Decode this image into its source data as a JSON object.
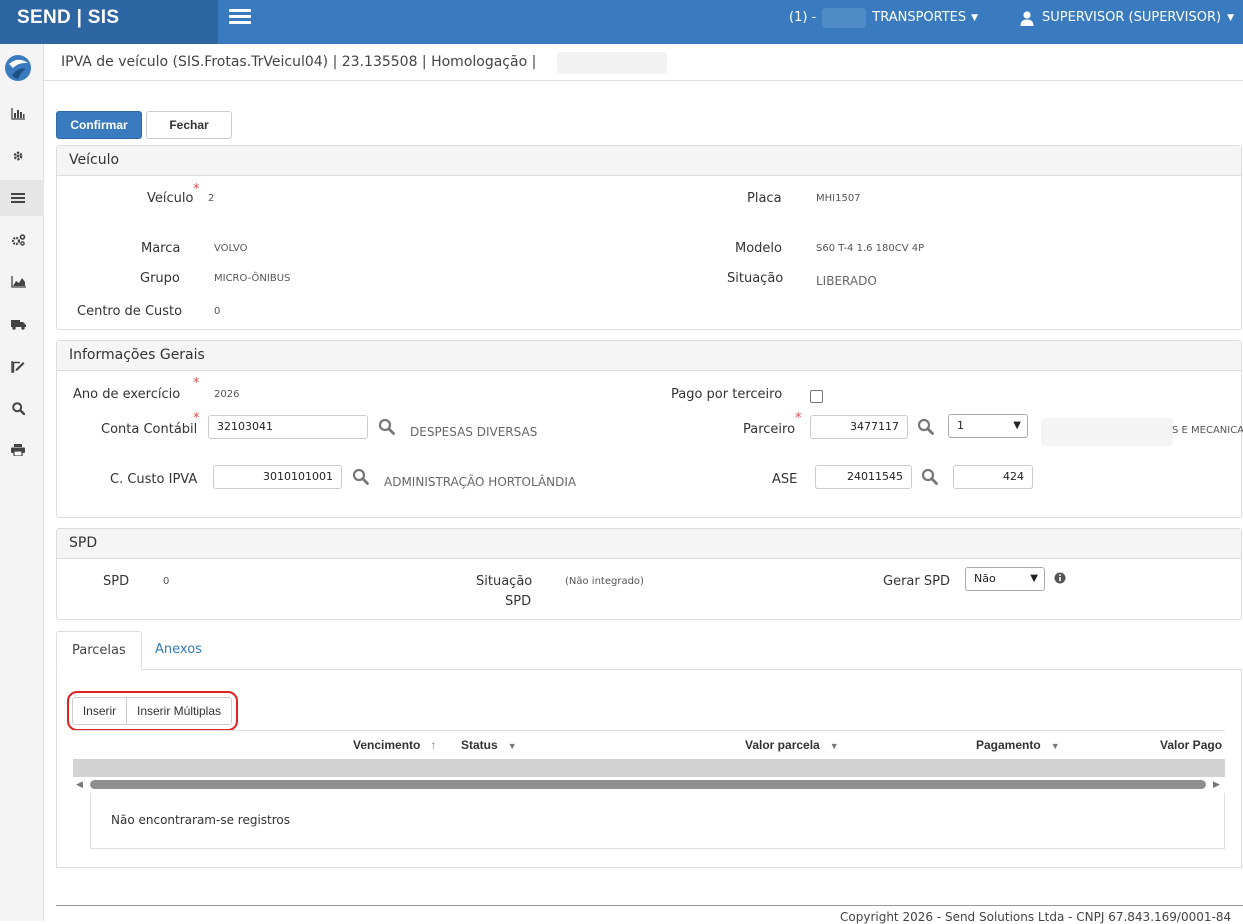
{
  "brand": "SEND | SIS",
  "topbar": {
    "company_prefix": "(1) -",
    "company": "TRANSPORTES",
    "user": "SUPERVISOR (SUPERVISOR)"
  },
  "page": {
    "title": "IPVA de veículo (SIS.Frotas.TrVeicul04) | 23.135508 | Homologação |"
  },
  "actions": {
    "confirm": "Confirmar",
    "close": "Fechar"
  },
  "veiculo": {
    "heading": "Veículo",
    "veiculo_label": "Veículo",
    "veiculo_value": "2",
    "placa_label": "Placa",
    "placa_value": "MHI1507",
    "marca_label": "Marca",
    "marca_value": "VOLVO",
    "modelo_label": "Modelo",
    "modelo_value": "S60 T-4 1.6 180CV 4P",
    "grupo_label": "Grupo",
    "grupo_value": "MICRO-ÔNIBUS",
    "situacao_label": "Situação",
    "situacao_value": "LIBERADO",
    "centro_label": "Centro de Custo",
    "centro_value": "0"
  },
  "info": {
    "heading": "Informações Gerais",
    "ano_label": "Ano de exercício",
    "ano_value": "2026",
    "pago_label": "Pago por terceiro",
    "conta_label": "Conta Contábil",
    "conta_value": "32103041",
    "conta_desc": "DESPESAS DIVERSAS",
    "parceiro_label": "Parceiro",
    "parceiro_value": "3477117",
    "parceiro_select": "1",
    "parceiro_desc": "S E MECANICA L",
    "custo_label": "C. Custo IPVA",
    "custo_value": "3010101001",
    "custo_desc": "ADMINISTRAÇÃO HORTOLÂNDIA",
    "ase_label": "ASE",
    "ase_value": "24011545",
    "ase_extra": "424"
  },
  "spd": {
    "heading": "SPD",
    "spd_label": "SPD",
    "spd_value": "0",
    "situacao_label_1": "Situação",
    "situacao_label_2": "SPD",
    "situacao_value": "(Não integrado)",
    "gerar_label": "Gerar SPD",
    "gerar_value": "Não"
  },
  "tabs": {
    "parcelas": "Parcelas",
    "anexos": "Anexos"
  },
  "parcelas": {
    "inserir": "Inserir",
    "inserir_multiplas": "Inserir Múltiplas",
    "columns": [
      "Vencimento",
      "Status",
      "Valor parcela",
      "Pagamento",
      "Valor Pago"
    ],
    "empty": "Não encontraram-se registros"
  },
  "footer": "Copyright 2026 - Send Solutions Ltda - CNPJ 67.843.169/0001-84"
}
